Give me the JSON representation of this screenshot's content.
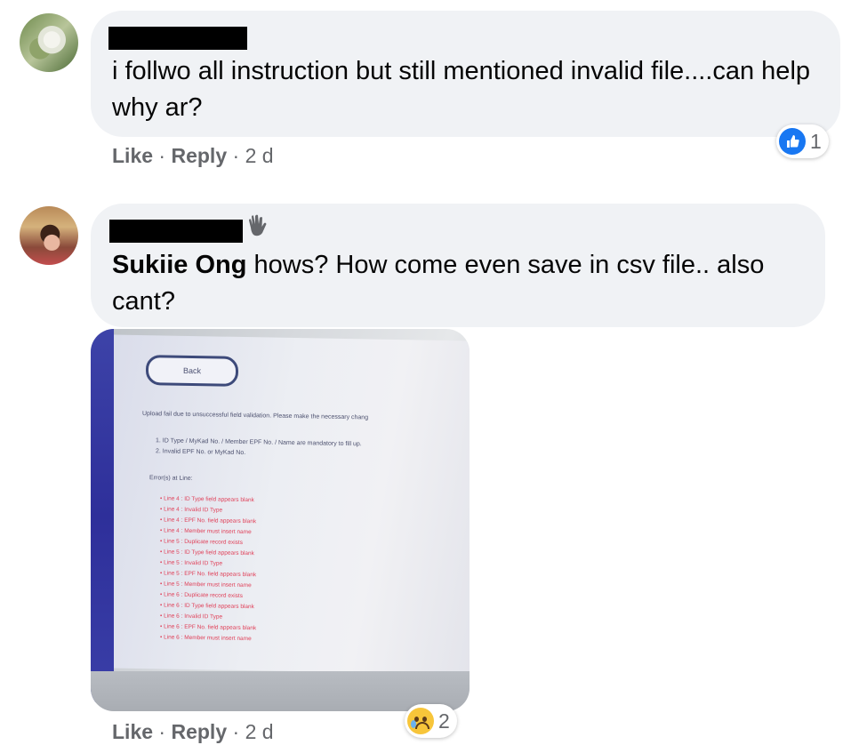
{
  "comments": [
    {
      "text": "i follwo all instruction but still mentioned invalid file....can help why ar?",
      "actions": {
        "like": "Like",
        "reply": "Reply",
        "time": "2 d",
        "sep": "·"
      },
      "reaction": {
        "icon": "thumbs-up-icon",
        "count": "1",
        "color": "#1877f2"
      }
    },
    {
      "mention": "Sukiie Ong",
      "text": " hows? How come even save in csv file.. also cant?",
      "badge_icon": "wave-hand-icon",
      "actions": {
        "like": "Like",
        "reply": "Reply",
        "time": "2 d",
        "sep": "·"
      },
      "reaction": {
        "icon": "sad-face-icon",
        "count": "2",
        "color": "#f7c53a"
      },
      "attachment": {
        "back_label": "Back",
        "message": "Upload fail due to unsuccessful field validation. Please make the necessary chang",
        "notes": [
          "1. ID Type / MyKad No. / Member EPF No. / Name are mandatory to fill up.",
          "2. Invalid EPF No. or MyKad No."
        ],
        "errors_heading": "Error(s) at Line:",
        "errors": [
          "Line 4 : ID Type field appears blank",
          "Line 4 : Invalid ID Type",
          "Line 4 : EPF No. field appears blank",
          "Line 4 : Member must insert name",
          "Line 5 : Duplicate record exists",
          "Line 5 : ID Type field appears blank",
          "Line 5 : Invalid ID Type",
          "Line 5 : EPF No. field appears blank",
          "Line 5 : Member must insert name",
          "Line 6 : Duplicate record exists",
          "Line 6 : ID Type field appears blank",
          "Line 6 : Invalid ID Type",
          "Line 6 : EPF No. field appears blank",
          "Line 6 : Member must insert name"
        ]
      }
    }
  ]
}
